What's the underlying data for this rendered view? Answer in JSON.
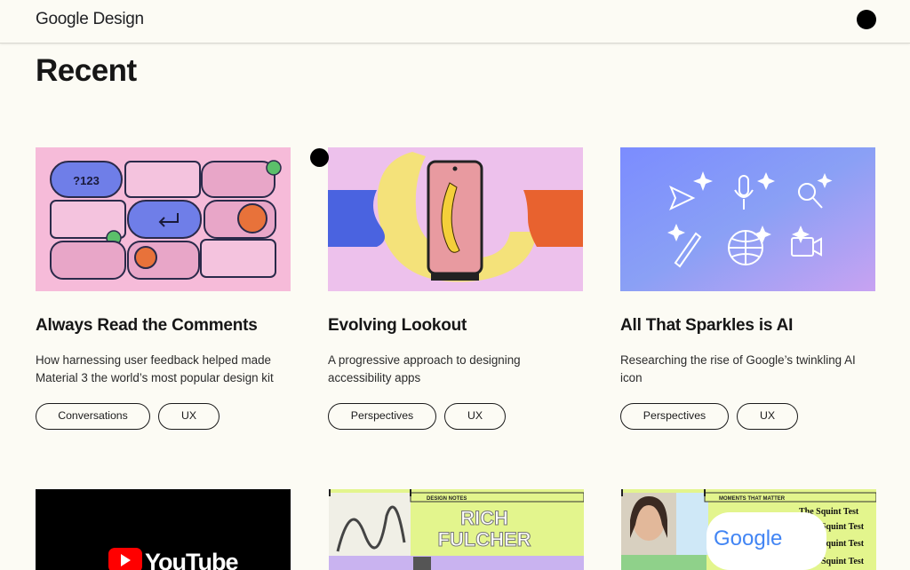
{
  "header": {
    "logo_text": "Google Design"
  },
  "section": {
    "title": "Recent"
  },
  "cards": [
    {
      "title": "Always Read the Comments",
      "description": "How harnessing user feedback helped made Material 3 the world’s most popular design kit",
      "tags": [
        "Conversations",
        "UX"
      ],
      "image_label": "?123"
    },
    {
      "title": "Evolving Lookout",
      "description": "A progressive approach to designing accessibility apps",
      "tags": [
        "Perspectives",
        "UX"
      ]
    },
    {
      "title": "All That Sparkles is AI",
      "description": "Researching the rise of Google’s twinkling AI icon",
      "tags": [
        "Perspectives",
        "UX"
      ]
    }
  ],
  "row2": {
    "youtube_text": "YouTube",
    "design_notes_label": "DESIGN NOTES",
    "design_notes_name_1": "RICH",
    "design_notes_name_2": "FULCHER",
    "squint_header": "MOMENTS THAT MATTER",
    "squint_test_lines": [
      "The Squint Test",
      "Squint Test",
      "Squint Test",
      "Squint Test"
    ],
    "google_logo_text": "Google"
  },
  "colors": {
    "background": "#fcfbf4",
    "text": "#161616",
    "pink": "#f6bbd9",
    "lilac": "#edc1ec",
    "blue_gradient_start": "#6f86ff",
    "lime": "#e3f58d"
  }
}
